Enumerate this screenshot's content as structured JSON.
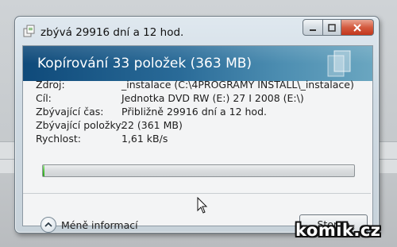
{
  "window": {
    "title": "zbývá 29916 dní a 12 hod.",
    "controls": {
      "minimize_icon": "minimize-icon",
      "maximize_icon": "maximize-icon",
      "close_icon": "close-icon",
      "close_color": "#c9432a"
    }
  },
  "header": {
    "title": "Kopírování 33 položek (363 MB)",
    "icon": "documents-icon",
    "band_color_start": "#0f4a7a",
    "band_color_end": "#6aa6c0"
  },
  "details": [
    {
      "label": "Zdroj:",
      "value": "_instalace (C:\\4PROGRAMY INSTALL\\_instalace)"
    },
    {
      "label": "Cíl:",
      "value": "Jednotka DVD RW (E:) 27 I 2008 (E:\\)"
    },
    {
      "label": "Zbývající čas:",
      "value": "Přibližně 29916 dní a 12 hod."
    },
    {
      "label": "Zbývající položky:",
      "value": "22 (361 MB)"
    },
    {
      "label": "Rychlost:",
      "value": "1,61 kB/s"
    }
  ],
  "progress": {
    "fraction": 0.005,
    "fill_color": "#4fc23e"
  },
  "footer": {
    "less_info_label": "Méně informací",
    "less_info_icon": "chevron-up-icon",
    "cancel_label": "Storno"
  },
  "watermark": {
    "text": "komik.cz"
  }
}
